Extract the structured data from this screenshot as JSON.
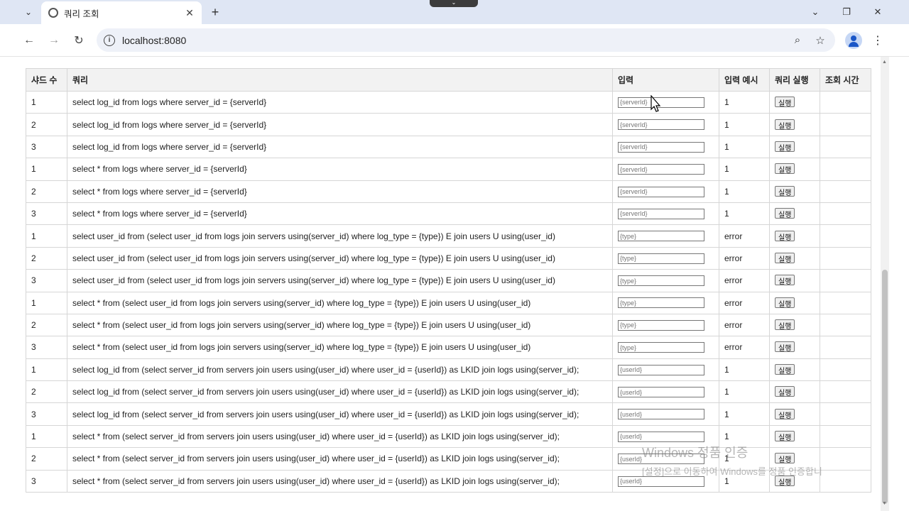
{
  "browser": {
    "tab_title": "쿼리 조회",
    "url": "localhost:8080",
    "notification_pill": "⌄"
  },
  "table": {
    "headers": [
      "샤드 수",
      "쿼리",
      "입력",
      "입력 예시",
      "쿼리 실행",
      "조회 시간"
    ],
    "run_label": "실행",
    "rows": [
      {
        "shard": "1",
        "query": "select log_id from logs where server_id = {serverId}",
        "placeholder": "{serverId}",
        "example": "1",
        "time": ""
      },
      {
        "shard": "2",
        "query": "select log_id from logs where server_id = {serverId}",
        "placeholder": "{serverId}",
        "example": "1",
        "time": ""
      },
      {
        "shard": "3",
        "query": "select log_id from logs where server_id = {serverId}",
        "placeholder": "{serverId}",
        "example": "1",
        "time": ""
      },
      {
        "shard": "1",
        "query": "select * from logs where server_id = {serverId}",
        "placeholder": "{serverId}",
        "example": "1",
        "time": ""
      },
      {
        "shard": "2",
        "query": "select * from logs where server_id = {serverId}",
        "placeholder": "{serverId}",
        "example": "1",
        "time": ""
      },
      {
        "shard": "3",
        "query": "select * from logs where server_id = {serverId}",
        "placeholder": "{serverId}",
        "example": "1",
        "time": ""
      },
      {
        "shard": "1",
        "query": "select user_id from (select user_id from logs join servers using(server_id) where log_type = {type}) E join users U using(user_id)",
        "placeholder": "{type}",
        "example": "error",
        "time": ""
      },
      {
        "shard": "2",
        "query": "select user_id from (select user_id from logs join servers using(server_id) where log_type = {type}) E join users U using(user_id)",
        "placeholder": "{type}",
        "example": "error",
        "time": ""
      },
      {
        "shard": "3",
        "query": "select user_id from (select user_id from logs join servers using(server_id) where log_type = {type}) E join users U using(user_id)",
        "placeholder": "{type}",
        "example": "error",
        "time": ""
      },
      {
        "shard": "1",
        "query": "select * from (select user_id from logs join servers using(server_id) where log_type = {type}) E join users U using(user_id)",
        "placeholder": "{type}",
        "example": "error",
        "time": ""
      },
      {
        "shard": "2",
        "query": "select * from (select user_id from logs join servers using(server_id) where log_type = {type}) E join users U using(user_id)",
        "placeholder": "{type}",
        "example": "error",
        "time": ""
      },
      {
        "shard": "3",
        "query": "select * from (select user_id from logs join servers using(server_id) where log_type = {type}) E join users U using(user_id)",
        "placeholder": "{type}",
        "example": "error",
        "time": ""
      },
      {
        "shard": "1",
        "query": "select log_id from (select server_id from servers join users using(user_id) where user_id = {userId}) as LKID join logs using(server_id);",
        "placeholder": "{userId}",
        "example": "1",
        "time": ""
      },
      {
        "shard": "2",
        "query": "select log_id from (select server_id from servers join users using(user_id) where user_id = {userId}) as LKID join logs using(server_id);",
        "placeholder": "{userId}",
        "example": "1",
        "time": ""
      },
      {
        "shard": "3",
        "query": "select log_id from (select server_id from servers join users using(user_id) where user_id = {userId}) as LKID join logs using(server_id);",
        "placeholder": "{userId}",
        "example": "1",
        "time": ""
      },
      {
        "shard": "1",
        "query": "select * from (select server_id from servers join users using(user_id) where user_id = {userId}) as LKID join logs using(server_id);",
        "placeholder": "{userId}",
        "example": "1",
        "time": ""
      },
      {
        "shard": "2",
        "query": "select * from (select server_id from servers join users using(user_id) where user_id = {userId}) as LKID join logs using(server_id);",
        "placeholder": "{userId}",
        "example": "1",
        "time": ""
      },
      {
        "shard": "3",
        "query": "select * from (select server_id from servers join users using(user_id) where user_id = {userId}) as LKID join logs using(server_id);",
        "placeholder": "{userId}",
        "example": "1",
        "time": ""
      }
    ]
  },
  "watermark": {
    "line1": "Windows 정품 인증",
    "line2": "[설정]으로 이동하여 Windows를 정품 인증합니"
  },
  "icons": [
    "chevron-down-icon",
    "globe-icon",
    "close-icon",
    "plus-icon",
    "minimize-icon",
    "restore-icon",
    "back-arrow-icon",
    "forward-arrow-icon",
    "reload-icon",
    "info-icon",
    "zoom-icon",
    "star-icon",
    "profile-icon",
    "more-vert-icon",
    "mouse-cursor-icon"
  ]
}
